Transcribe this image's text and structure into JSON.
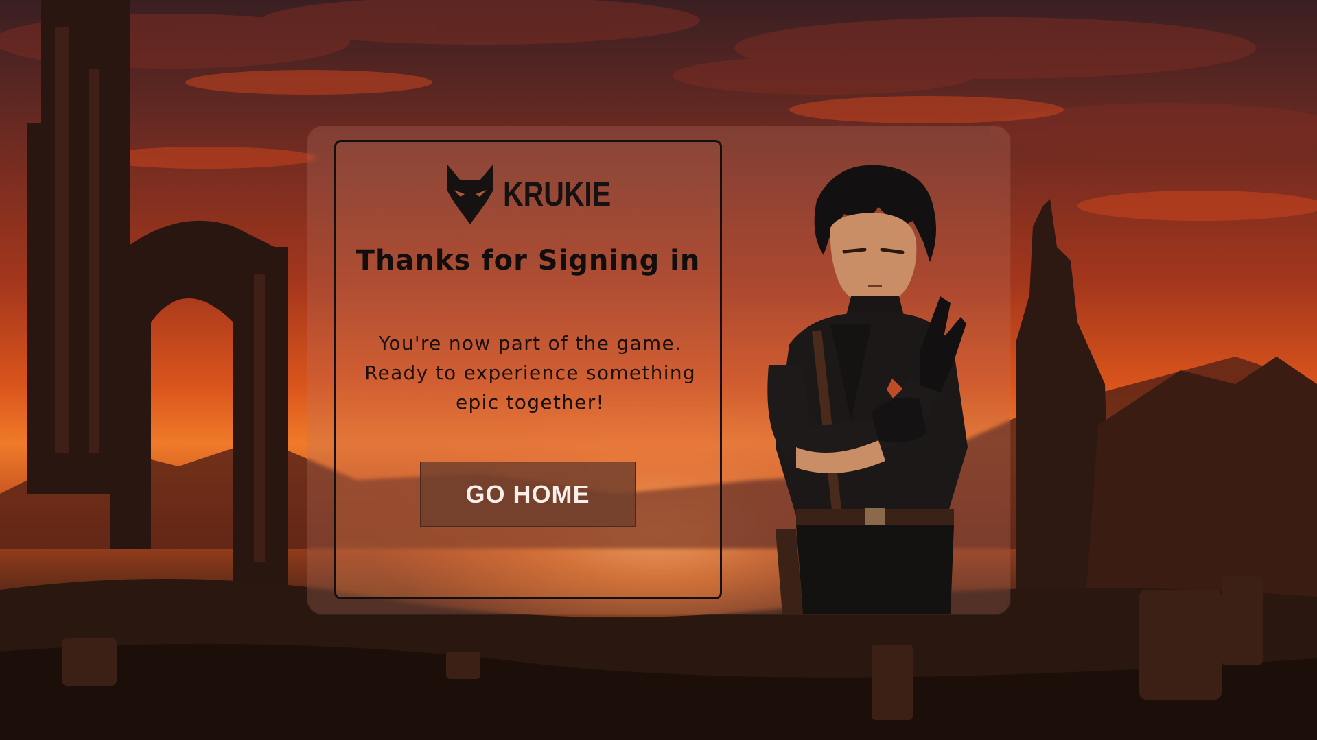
{
  "brand": {
    "name": "KRUKIE",
    "logo_icon": "fox-mask-icon"
  },
  "confirmation": {
    "title": "Thanks for Signing in",
    "message_lines": [
      "You're now part of the game.",
      "Ready to experience something",
      "epic together!"
    ]
  },
  "actions": {
    "go_home_label": "GO HOME"
  },
  "colors": {
    "sky_dark": "#3a1f22",
    "sunset_orange": "#f07a2a",
    "button_bg": "#6e3e2c",
    "text_dark": "#120e0e",
    "button_text": "#f7efe9"
  }
}
